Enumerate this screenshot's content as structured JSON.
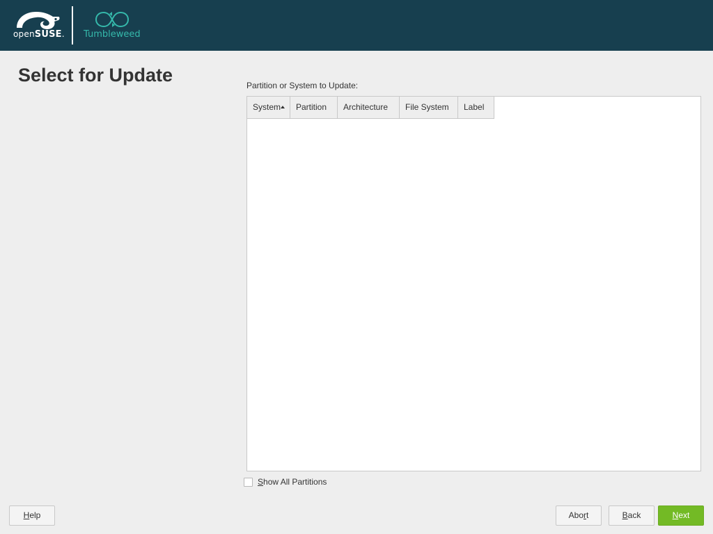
{
  "header": {
    "brand_main": "open",
    "brand_bold": "SUSE",
    "brand_mark": ".",
    "product": "Tumbleweed",
    "colors": {
      "background": "#173f4f",
      "tumbleweed": "#35b9ab"
    },
    "icons": [
      "opensuse-gecko-logo-icon",
      "tumbleweed-infinity-icon"
    ]
  },
  "page": {
    "title": "Select for Update"
  },
  "table": {
    "caption": "Partition or System to Update:",
    "columns": [
      "System",
      "Partition",
      "Architecture",
      "File System",
      "Label"
    ],
    "sorted_column": "System",
    "sort_direction": "ascending",
    "rows": []
  },
  "options": {
    "show_all_partitions": {
      "label_underlined": "S",
      "label_rest": "how All Partitions",
      "checked": false
    }
  },
  "buttons": {
    "help": {
      "u": "H",
      "rest": "elp"
    },
    "abort": {
      "pre": "Abo",
      "u": "r",
      "rest": "t"
    },
    "back": {
      "u": "B",
      "rest": "ack"
    },
    "next": {
      "u": "N",
      "rest": "ext",
      "color": "#73ba25"
    }
  }
}
